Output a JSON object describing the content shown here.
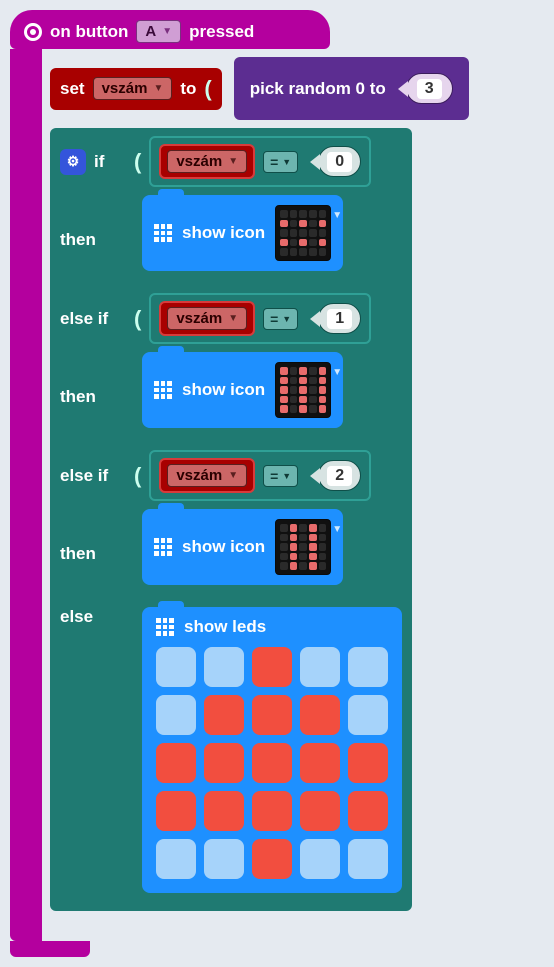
{
  "hat": {
    "prefix": "on button",
    "button": "A",
    "suffix": "pressed"
  },
  "set": {
    "label_set": "set",
    "var": "vszám",
    "label_to": "to"
  },
  "random": {
    "label": "pick random 0 to",
    "max": "3"
  },
  "if_label": "if",
  "then_label": "then",
  "elseif_label": "else if",
  "else_label": "else",
  "eq_op": "=",
  "paren_open": "(",
  "conditions": [
    {
      "var": "vszám",
      "val": "0"
    },
    {
      "var": "vszám",
      "val": "1"
    },
    {
      "var": "vszám",
      "val": "2"
    }
  ],
  "show_icon_label": "show icon",
  "show_leds_label": "show leds",
  "chart_data": {
    "type": "table",
    "title": "show leds pattern (5x5, 1=on)",
    "data": [
      [
        0,
        0,
        1,
        0,
        0
      ],
      [
        0,
        1,
        1,
        1,
        0
      ],
      [
        1,
        1,
        1,
        1,
        1
      ],
      [
        1,
        1,
        1,
        1,
        1
      ],
      [
        0,
        0,
        1,
        0,
        0
      ]
    ],
    "icons": [
      {
        "cond": 0,
        "pattern": [
          [
            0,
            0,
            0,
            0,
            0
          ],
          [
            1,
            0,
            1,
            0,
            1
          ],
          [
            0,
            0,
            0,
            0,
            0
          ],
          [
            1,
            0,
            1,
            0,
            1
          ],
          [
            0,
            0,
            0,
            0,
            0
          ]
        ]
      },
      {
        "cond": 1,
        "pattern": [
          [
            1,
            0,
            1,
            0,
            1
          ],
          [
            1,
            0,
            1,
            0,
            1
          ],
          [
            1,
            0,
            1,
            0,
            1
          ],
          [
            1,
            0,
            1,
            0,
            1
          ],
          [
            1,
            0,
            1,
            0,
            1
          ]
        ]
      },
      {
        "cond": 2,
        "pattern": [
          [
            0,
            1,
            0,
            1,
            0
          ],
          [
            0,
            1,
            0,
            1,
            0
          ],
          [
            0,
            1,
            0,
            1,
            0
          ],
          [
            0,
            1,
            0,
            1,
            0
          ],
          [
            0,
            1,
            0,
            1,
            0
          ]
        ]
      }
    ]
  }
}
